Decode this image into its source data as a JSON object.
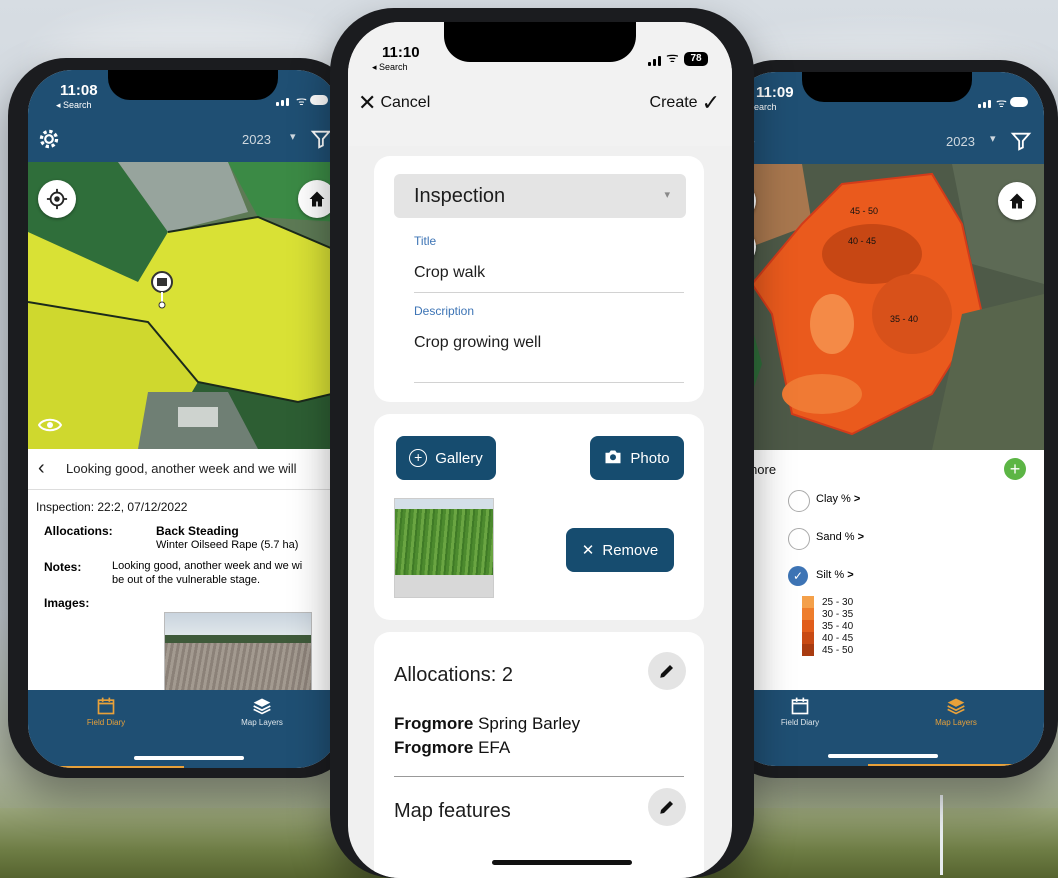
{
  "left_phone": {
    "time": "11:08",
    "back": "◂ Search",
    "year": "2023",
    "list_header": "Looking good, another week and we will",
    "inspection_line": "Inspection: 22:2, 07/12/2022",
    "allocations_label": "Allocations:",
    "allocations_field": "Back Steading",
    "allocations_crop": "Winter Oilseed Rape (5.7 ha)",
    "notes_label": "Notes:",
    "notes_line1": "Looking good, another week and we wi",
    "notes_line2": "be out of the vulnerable stage.",
    "images_label": "Images:",
    "tabs": [
      "Field Diary",
      "Map Layers"
    ]
  },
  "center_phone": {
    "time": "11:10",
    "back": "◂ Search",
    "battery": "78",
    "cancel": "Cancel",
    "create": "Create",
    "type_select": "Inspection",
    "title_label": "Title",
    "title_value": "Crop walk",
    "description_label": "Description",
    "description_value": "Crop growing well",
    "gallery_button": "Gallery",
    "photo_button": "Photo",
    "remove_button": "Remove",
    "allocations_title": "Allocations: 2",
    "allocation_1_field": "Frogmore",
    "allocation_1_crop": "Spring Barley",
    "allocation_2_field": "Frogmore",
    "allocation_2_crop": "EFA",
    "map_features": "Map features"
  },
  "right_phone": {
    "time": "11:09",
    "back": "earch",
    "year": "2023",
    "zone_labels": [
      "45 - 50",
      "40 - 45",
      "35 - 40"
    ],
    "field_name": "ogmore",
    "layers": [
      "Clay %",
      "Sand %",
      "Silt %"
    ],
    "legend": [
      "25 - 30",
      "30 - 35",
      "35 - 40",
      "40 - 45",
      "45 - 50"
    ],
    "legend_colors": [
      "#f4a04a",
      "#ee7d2c",
      "#e15d1b",
      "#c84a14",
      "#a93c11"
    ],
    "tabs": [
      "Field Diary",
      "Map Layers"
    ]
  },
  "colors": {
    "header_blue": "#1f4f73",
    "button_blue": "#164c6f",
    "link_blue": "#3d74b5",
    "accent_orange": "#e8a13a",
    "add_green": "#5cb545"
  }
}
